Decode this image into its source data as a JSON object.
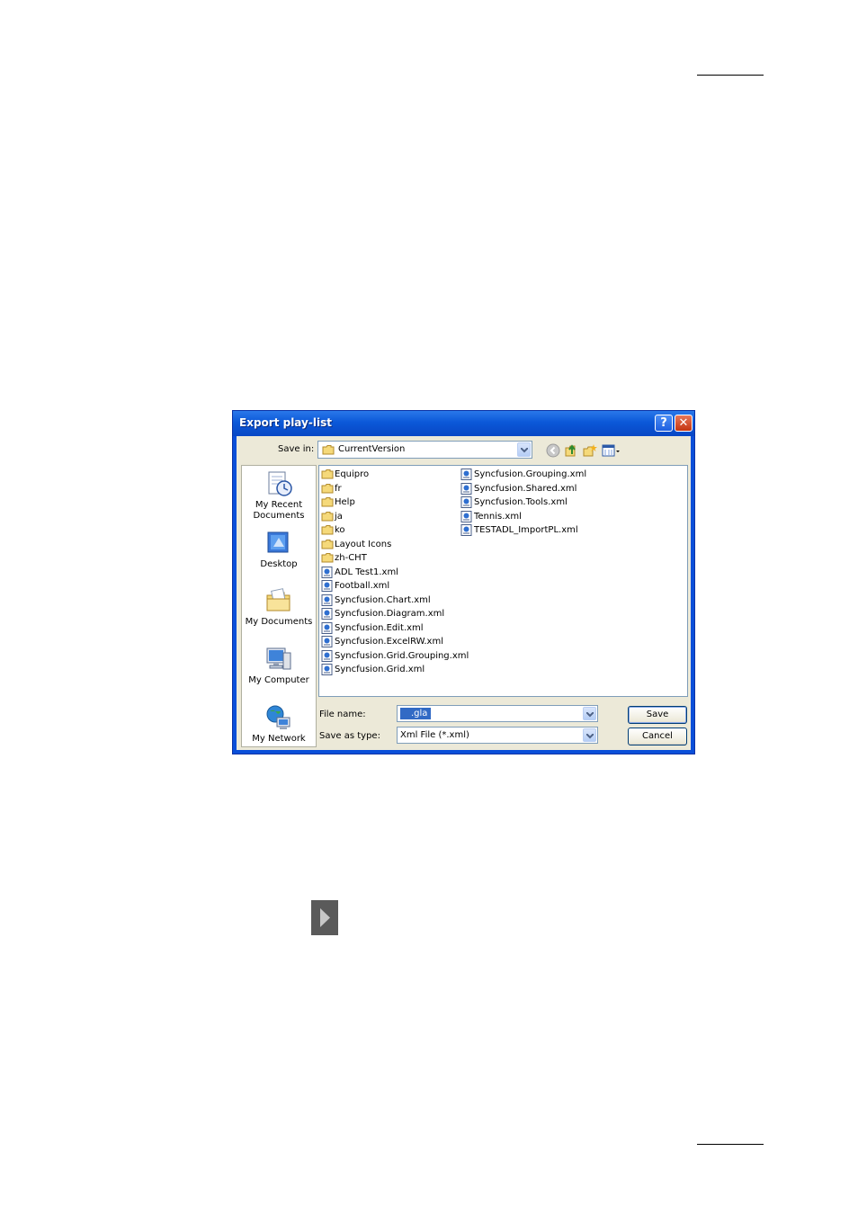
{
  "dialog": {
    "title": "Export play-list",
    "help_label": "?",
    "close_label": "✕",
    "save_in": {
      "label": "Save in:",
      "value": "CurrentVersion"
    },
    "places": [
      {
        "label": "My Recent Documents",
        "icon": "recent-documents-icon"
      },
      {
        "label": "Desktop",
        "icon": "desktop-icon"
      },
      {
        "label": "My Documents",
        "icon": "my-documents-icon"
      },
      {
        "label": "My Computer",
        "icon": "my-computer-icon"
      },
      {
        "label": "My Network",
        "icon": "my-network-icon"
      }
    ],
    "files": [
      {
        "name": "Equipro",
        "type": "folder"
      },
      {
        "name": "fr",
        "type": "folder"
      },
      {
        "name": "Help",
        "type": "folder"
      },
      {
        "name": "ja",
        "type": "folder"
      },
      {
        "name": "ko",
        "type": "folder"
      },
      {
        "name": "Layout Icons",
        "type": "folder"
      },
      {
        "name": "zh-CHT",
        "type": "folder"
      },
      {
        "name": "ADL Test1.xml",
        "type": "xml"
      },
      {
        "name": "Football.xml",
        "type": "xml"
      },
      {
        "name": "Syncfusion.Chart.xml",
        "type": "xml"
      },
      {
        "name": "Syncfusion.Diagram.xml",
        "type": "xml"
      },
      {
        "name": "Syncfusion.Edit.xml",
        "type": "xml"
      },
      {
        "name": "Syncfusion.ExcelRW.xml",
        "type": "xml"
      },
      {
        "name": "Syncfusion.Grid.Grouping.xml",
        "type": "xml"
      },
      {
        "name": "Syncfusion.Grid.xml",
        "type": "xml"
      },
      {
        "name": "Syncfusion.Grouping.xml",
        "type": "xml"
      },
      {
        "name": "Syncfusion.Shared.xml",
        "type": "xml"
      },
      {
        "name": "Syncfusion.Tools.xml",
        "type": "xml"
      },
      {
        "name": "Tennis.xml",
        "type": "xml"
      },
      {
        "name": "TESTADL_ImportPL.xml",
        "type": "xml"
      }
    ],
    "file_name": {
      "label": "File name:",
      "value": ".gla"
    },
    "save_as_type": {
      "label": "Save as type:",
      "value": "Xml File (*.xml)"
    },
    "save_label": "Save",
    "cancel_label": "Cancel",
    "colors": {
      "title_bar": "#0b58d8",
      "selection": "#316ac5",
      "face": "#ece9d8"
    }
  }
}
